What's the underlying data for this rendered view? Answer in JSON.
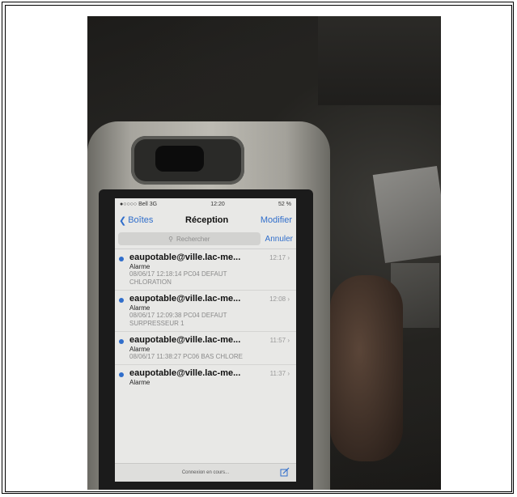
{
  "status_bar": {
    "carrier": "●○○○○ Bell 3G",
    "time": "12:20",
    "battery": "52 %"
  },
  "nav": {
    "back_label": "Boîtes",
    "title": "Réception",
    "edit_label": "Modifier"
  },
  "search": {
    "placeholder": "Rechercher",
    "cancel_label": "Annuler"
  },
  "messages": [
    {
      "from": "eaupotable@ville.lac-me...",
      "time": "12:17",
      "subject": "Alarme",
      "preview_line1": "08/06/17 12:18:14 PC04 DEFAUT",
      "preview_line2": "CHLORATION"
    },
    {
      "from": "eaupotable@ville.lac-me...",
      "time": "12:08",
      "subject": "Alarme",
      "preview_line1": "08/06/17 12:09:38 PC04 DEFAUT",
      "preview_line2": "SURPRESSEUR 1"
    },
    {
      "from": "eaupotable@ville.lac-me...",
      "time": "11:57",
      "subject": "Alarme",
      "preview_line1": "08/06/17 11:38:27 PC06 BAS CHLORE",
      "preview_line2": ""
    },
    {
      "from": "eaupotable@ville.lac-me...",
      "time": "11:37",
      "subject": "Alarme",
      "preview_line1": "",
      "preview_line2": ""
    }
  ],
  "toolbar": {
    "status": "Connexion en cours..."
  },
  "colors": {
    "accent": "#2a6fd6"
  }
}
